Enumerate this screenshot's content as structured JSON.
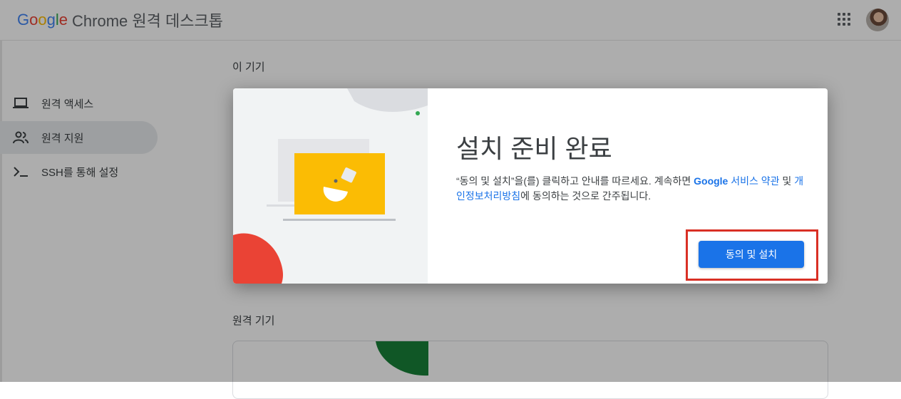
{
  "header": {
    "logo_letters": [
      "G",
      "o",
      "o",
      "g",
      "l",
      "e"
    ],
    "product": "Chrome 원격 데스크톱",
    "apps_icon": "apps-grid-icon",
    "avatar_icon": "user-avatar"
  },
  "sidebar": {
    "items": [
      {
        "label": "원격 액세스",
        "icon": "laptop-icon",
        "active": false
      },
      {
        "label": "원격 지원",
        "icon": "people-icon",
        "active": true
      },
      {
        "label": "SSH를 통해 설정",
        "icon": "terminal-icon",
        "active": false
      }
    ]
  },
  "main": {
    "this_device_title": "이 기기",
    "remote_devices_title": "원격 기기"
  },
  "dialog": {
    "title": "설치 준비 완료",
    "desc_before": "“동의 및 설치”을(를) 클릭하고 안내를 따르세요. 계속하면 ",
    "link_terms_brand": "Google",
    "link_terms": " 서비스 약관",
    "desc_mid": " 및 ",
    "link_privacy": "개인정보처리방침",
    "desc_after": "에 동의하는 것으로 간주됩니다.",
    "button_label": "동의 및 설치"
  },
  "colors": {
    "accent": "#1a73e8",
    "highlight": "#d93025",
    "illustration_yellow": "#fbbc04",
    "illustration_red": "#ea4335",
    "illustration_green": "#34a853"
  }
}
